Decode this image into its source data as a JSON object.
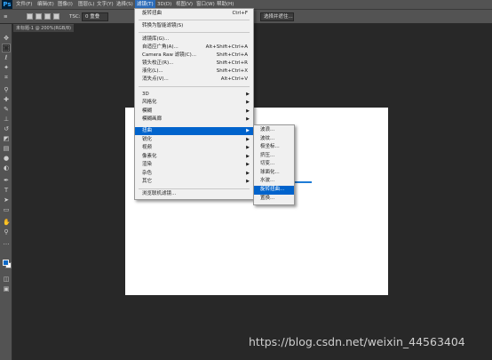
{
  "app": {
    "logo": "Ps"
  },
  "menubar": {
    "items": [
      {
        "label": "文件(F)"
      },
      {
        "label": "编辑(E)"
      },
      {
        "label": "图像(I)"
      },
      {
        "label": "图层(L)"
      },
      {
        "label": "文字(Y)"
      },
      {
        "label": "选择(S)"
      },
      {
        "label": "滤镜(T)",
        "active": true
      },
      {
        "label": "3D(D)"
      },
      {
        "label": "视图(V)"
      },
      {
        "label": "窗口(W)"
      },
      {
        "label": "帮助(H)"
      }
    ]
  },
  "options": {
    "menu_icon": "≡",
    "tsc_label": "TSC:",
    "tsc_value": "0 重叠",
    "select_label": "选择并遮住..."
  },
  "document": {
    "tab_label": "未标题-1 @ 200%(RGB/8)",
    "close": "×"
  },
  "filter_menu": {
    "items": [
      {
        "label": "旋转扭曲",
        "shortcut": "Ctrl+F"
      },
      {
        "label": "转换为智能滤镜(S)"
      },
      {
        "label": "滤镜库(G)..."
      },
      {
        "label": "自适应广角(A)...",
        "shortcut": "Alt+Shift+Ctrl+A"
      },
      {
        "label": "Camera Raw 滤镜(C)...",
        "shortcut": "Shift+Ctrl+A"
      },
      {
        "label": "镜头校正(R)...",
        "shortcut": "Shift+Ctrl+R"
      },
      {
        "label": "液化(L)...",
        "shortcut": "Shift+Ctrl+X"
      },
      {
        "label": "消失点(V)...",
        "shortcut": "Alt+Ctrl+V"
      },
      {
        "label": "3D",
        "submenu": true
      },
      {
        "label": "风格化",
        "submenu": true
      },
      {
        "label": "模糊",
        "submenu": true
      },
      {
        "label": "模糊画廊",
        "submenu": true
      },
      {
        "label": "扭曲",
        "submenu": true,
        "highlighted": true
      },
      {
        "label": "锐化",
        "submenu": true
      },
      {
        "label": "视频",
        "submenu": true
      },
      {
        "label": "像素化",
        "submenu": true
      },
      {
        "label": "渲染",
        "submenu": true
      },
      {
        "label": "杂色",
        "submenu": true
      },
      {
        "label": "其它",
        "submenu": true
      },
      {
        "label": "浏览联机滤镜..."
      }
    ]
  },
  "distort_submenu": {
    "items": [
      {
        "label": "波浪..."
      },
      {
        "label": "波纹..."
      },
      {
        "label": "极坐标..."
      },
      {
        "label": "挤压..."
      },
      {
        "label": "切变..."
      },
      {
        "label": "球面化..."
      },
      {
        "label": "水波..."
      },
      {
        "label": "旋转扭曲...",
        "highlighted": true
      },
      {
        "label": "置换..."
      }
    ]
  },
  "watermark": "https://blog.csdn.net/weixin_44563404",
  "colors": {
    "accent": "#0063cc",
    "foreground_swatch": "#0c69c7",
    "background_swatch": "#ffffff"
  },
  "tools": [
    "move-tool-icon",
    "marquee-tool-icon",
    "lasso-tool-icon",
    "magic-wand-icon",
    "crop-tool-icon",
    "eyedropper-icon",
    "healing-brush-icon",
    "brush-tool-icon",
    "clone-stamp-icon",
    "history-brush-icon",
    "eraser-icon",
    "gradient-tool-icon",
    "blur-tool-icon",
    "dodge-tool-icon",
    "pen-tool-icon",
    "type-tool-icon",
    "path-selection-icon",
    "shape-tool-icon",
    "hand-tool-icon",
    "zoom-tool-icon"
  ]
}
